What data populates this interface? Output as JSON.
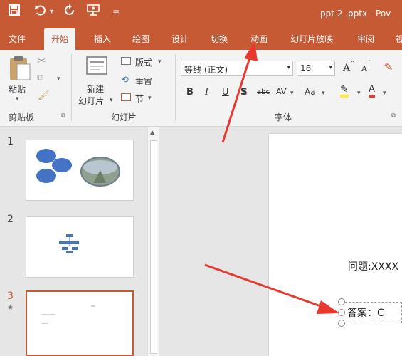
{
  "titlebar": {
    "save_icon": "save-icon",
    "undo_icon": "undo-icon",
    "redo_icon": "redo-icon",
    "document_title": "ppt 2 .pptx - Pov"
  },
  "tabs": [
    {
      "label": "文件"
    },
    {
      "label": "开始"
    },
    {
      "label": "插入"
    },
    {
      "label": "绘图"
    },
    {
      "label": "设计"
    },
    {
      "label": "切换"
    },
    {
      "label": "动画"
    },
    {
      "label": "幻灯片放映"
    },
    {
      "label": "审阅"
    },
    {
      "label": "视"
    }
  ],
  "ribbon": {
    "clipboard": {
      "paste_label": "粘贴",
      "group_label": "剪贴板"
    },
    "slides": {
      "new_slide_line1": "新建",
      "new_slide_line2": "幻灯片",
      "layout_label": "版式",
      "reset_label": "重置",
      "section_label": "节",
      "group_label": "幻灯片"
    },
    "font": {
      "font_name": "等线 (正文)",
      "font_size": "18",
      "grow_label": "A",
      "shrink_label": "A",
      "bold": "B",
      "italic": "I",
      "underline": "U",
      "shadow": "S",
      "strike": "abc",
      "spacing": "AV",
      "case": "Aa",
      "font_color": "A",
      "group_label": "字体"
    }
  },
  "slides_panel": {
    "slides": [
      {
        "number": "1"
      },
      {
        "number": "2"
      },
      {
        "number": "3"
      }
    ],
    "star": "★"
  },
  "current_slide": {
    "question": "问题:XXXX",
    "answer": "答案：C"
  },
  "colors": {
    "accent": "#c55a35",
    "arrow": "#e8392f",
    "shape_blue": "#4472c4"
  }
}
